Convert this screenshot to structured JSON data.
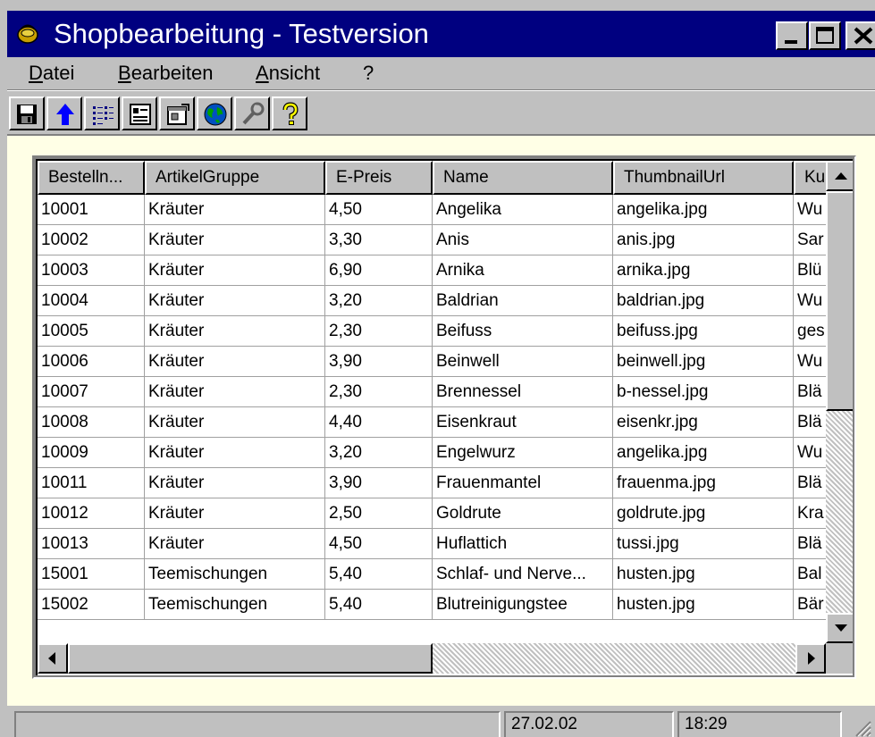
{
  "window": {
    "title": "Shopbearbeitung - Testversion",
    "title_bar_color": "#000080",
    "workspace_color": "#ffffe6",
    "controls": [
      "minimize-icon",
      "maximize-icon",
      "close-icon"
    ]
  },
  "menu": {
    "items": [
      "Datei",
      "Bearbeiten",
      "Ansicht",
      "?"
    ]
  },
  "toolbar": {
    "buttons": [
      {
        "icon": "save-icon"
      },
      {
        "icon": "arrow-up-icon"
      },
      {
        "icon": "details-list-icon"
      },
      {
        "icon": "form-view-icon"
      },
      {
        "icon": "properties-icon"
      },
      {
        "icon": "globe-icon"
      },
      {
        "icon": "tools-icon"
      },
      {
        "icon": "help-icon"
      }
    ]
  },
  "grid": {
    "columns": [
      "Bestelln...",
      "ArtikelGruppe",
      "E-Preis",
      "Name",
      "ThumbnailUrl",
      "Ku"
    ],
    "rows": [
      [
        "10001",
        "Kräuter",
        "4,50",
        "Angelika",
        "angelika.jpg",
        "Wu"
      ],
      [
        "10002",
        "Kräuter",
        "3,30",
        "Anis",
        "anis.jpg",
        "Sar"
      ],
      [
        "10003",
        "Kräuter",
        "6,90",
        "Arnika",
        "arnika.jpg",
        "Blü"
      ],
      [
        "10004",
        "Kräuter",
        "3,20",
        "Baldrian",
        "baldrian.jpg",
        "Wu"
      ],
      [
        "10005",
        "Kräuter",
        "2,30",
        "Beifuss",
        "beifuss.jpg",
        "ges"
      ],
      [
        "10006",
        "Kräuter",
        "3,90",
        "Beinwell",
        "beinwell.jpg",
        "Wu"
      ],
      [
        "10007",
        "Kräuter",
        "2,30",
        "Brennessel",
        "b-nessel.jpg",
        "Blä"
      ],
      [
        "10008",
        "Kräuter",
        "4,40",
        "Eisenkraut",
        "eisenkr.jpg",
        "Blä"
      ],
      [
        "10009",
        "Kräuter",
        "3,20",
        "Engelwurz",
        "angelika.jpg",
        "Wu"
      ],
      [
        "10011",
        "Kräuter",
        "3,90",
        "Frauenmantel",
        "frauenma.jpg",
        "Blä"
      ],
      [
        "10012",
        "Kräuter",
        "2,50",
        "Goldrute",
        "goldrute.jpg",
        "Kra"
      ],
      [
        "10013",
        "Kräuter",
        "4,50",
        "Huflattich",
        "tussi.jpg",
        "Blä"
      ],
      [
        "15001",
        "Teemischungen",
        "5,40",
        "Schlaf- und Nerve...",
        "husten.jpg",
        "Bal"
      ],
      [
        "15002",
        "Teemischungen",
        "5,40",
        "Blutreinigungstee",
        "husten.jpg",
        "Bär"
      ]
    ]
  },
  "statusbar": {
    "panes": [
      "",
      "27.02.02",
      "18:29"
    ]
  }
}
